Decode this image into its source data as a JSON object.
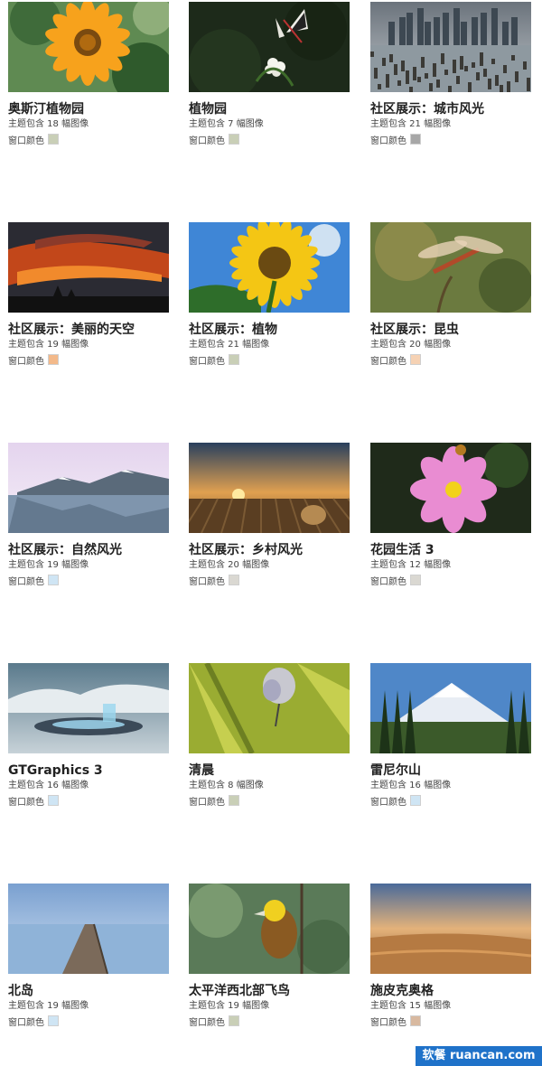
{
  "themes": [
    {
      "title": "奥斯汀植物园",
      "count": "主题包含 18 幅图像",
      "window_color_label": "窗口颜色",
      "swatch_color": "#c9cfb7",
      "scene": "flower-orange"
    },
    {
      "title": "植物园",
      "count": "主题包含 7 幅图像",
      "window_color_label": "窗口颜色",
      "swatch_color": "#c9cfb7",
      "scene": "butterfly-dark"
    },
    {
      "title": "社区展示：城市风光",
      "count": "主题包含 21 幅图像",
      "window_color_label": "窗口颜色",
      "swatch_color": "#a7a7a7",
      "scene": "city-pier"
    },
    {
      "title": "社区展示：美丽的天空",
      "count": "主题包含 19 幅图像",
      "window_color_label": "窗口颜色",
      "swatch_color": "#f3b98a",
      "scene": "sunset-sky"
    },
    {
      "title": "社区展示：植物",
      "count": "主题包含 21 幅图像",
      "window_color_label": "窗口颜色",
      "swatch_color": "#c9cfb7",
      "scene": "sunflower"
    },
    {
      "title": "社区展示：昆虫",
      "count": "主题包含 20 幅图像",
      "window_color_label": "窗口颜色",
      "swatch_color": "#f6d2b4",
      "scene": "dragonfly"
    },
    {
      "title": "社区展示：自然风光",
      "count": "主题包含 19 幅图像",
      "window_color_label": "窗口颜色",
      "swatch_color": "#cfe5f4",
      "scene": "mountain-lake"
    },
    {
      "title": "社区展示：乡村风光",
      "count": "主题包含 20 幅图像",
      "window_color_label": "窗口颜色",
      "swatch_color": "#dad8d2",
      "scene": "rural-sunset"
    },
    {
      "title": "花园生活 3",
      "count": "主题包含 12 幅图像",
      "window_color_label": "窗口颜色",
      "swatch_color": "#dad8d2",
      "scene": "cosmos"
    },
    {
      "title": "GTGraphics 3",
      "count": "主题包含 16 幅图像",
      "window_color_label": "窗口颜色",
      "swatch_color": "#cfe5f4",
      "scene": "fantasy"
    },
    {
      "title": "清晨",
      "count": "主题包含 8 幅图像",
      "window_color_label": "窗口颜色",
      "swatch_color": "#c9cfb7",
      "scene": "blue-butterfly"
    },
    {
      "title": "雷尼尔山",
      "count": "主题包含 16 幅图像",
      "window_color_label": "窗口颜色",
      "swatch_color": "#cfe5f4",
      "scene": "rainier"
    },
    {
      "title": "北岛",
      "count": "主题包含 19 幅图像",
      "window_color_label": "窗口颜色",
      "swatch_color": "#cfe5f4",
      "scene": "pier-sea"
    },
    {
      "title": "太平洋西北部飞鸟",
      "count": "主题包含 19 幅图像",
      "window_color_label": "窗口颜色",
      "swatch_color": "#c9cfb7",
      "scene": "bird"
    },
    {
      "title": "施皮克奥格",
      "count": "主题包含 15 幅图像",
      "window_color_label": "窗口颜色",
      "swatch_color": "#d8b9a0",
      "scene": "beach-dusk"
    }
  ],
  "watermark": "软餐 ruancan.com"
}
